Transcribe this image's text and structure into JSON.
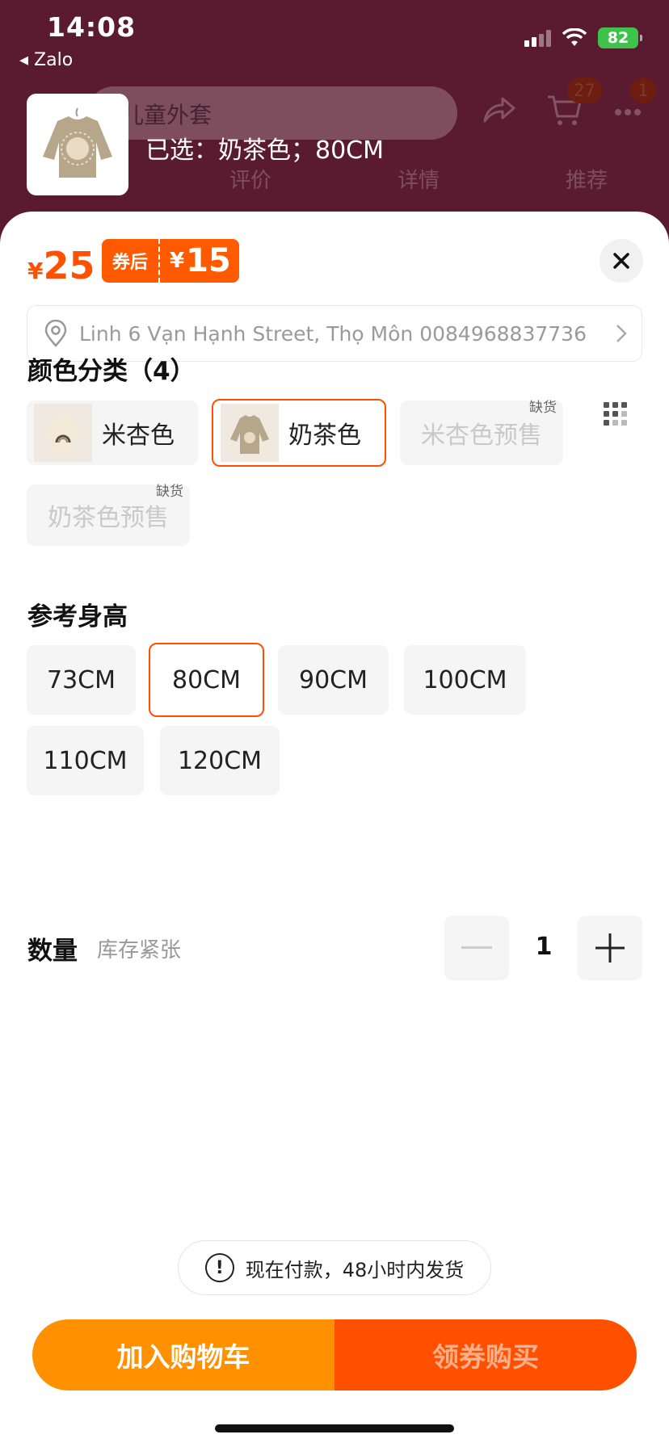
{
  "status_bar": {
    "time": "14:08",
    "back_app": "◂ Zalo",
    "battery": "82"
  },
  "header": {
    "search_text": "儿童外套",
    "cart_badge": "27",
    "more_badge": "1",
    "tabs": [
      "评价",
      "详情",
      "推荐"
    ],
    "selected_text": "已选：奶茶色；80CM"
  },
  "sheet": {
    "price_symbol": "¥",
    "price": "25",
    "coupon_label": "券后",
    "coupon_symbol": "¥",
    "coupon_price": "15",
    "address": "Linh 6 Vạn Hạnh Street, Thọ Môn 0084968837736",
    "color_section_title": "颜色分类（4）",
    "colors": [
      {
        "label": "米杏色",
        "selected": false,
        "available": true
      },
      {
        "label": "奶茶色",
        "selected": true,
        "available": true
      },
      {
        "label": "米杏色预售",
        "selected": false,
        "available": false,
        "tag": "缺货"
      },
      {
        "label": "奶茶色预售",
        "selected": false,
        "available": false,
        "tag": "缺货"
      }
    ],
    "size_section_title": "参考身高",
    "sizes": [
      {
        "label": "73CM",
        "selected": false
      },
      {
        "label": "80CM",
        "selected": true
      },
      {
        "label": "90CM",
        "selected": false
      },
      {
        "label": "100CM",
        "selected": false
      },
      {
        "label": "110CM",
        "selected": false
      },
      {
        "label": "120CM",
        "selected": false
      }
    ],
    "quantity_label": "数量",
    "quantity_hint": "库存紧张",
    "quantity_value": "1",
    "notice": "现在付款，48小时内发货",
    "add_to_cart": "加入购物车",
    "coupon_buy": "领券购买"
  },
  "colors": {
    "accent": "#ff5000",
    "cart_button": "#ff9000",
    "backdrop": "#5a1b31"
  }
}
